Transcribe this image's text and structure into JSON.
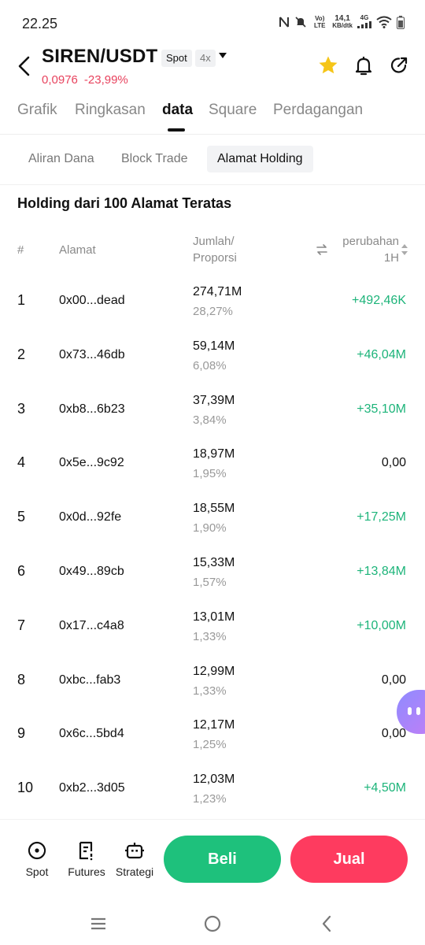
{
  "status_bar": {
    "time": "22.25",
    "network_volte": "Vo) LTE",
    "speed_value": "14,1",
    "speed_unit": "KB/dtk",
    "network_type": "4G"
  },
  "header": {
    "pair": "SIREN/USDT",
    "market_badge": "Spot",
    "leverage_badge": "4x",
    "price": "0,0976",
    "change": "-23,99%",
    "colors": {
      "negative": "#e8435e",
      "favorite": "#f5c518"
    }
  },
  "main_tabs": [
    {
      "label": "Grafik",
      "active": false
    },
    {
      "label": "Ringkasan",
      "active": false
    },
    {
      "label": "data",
      "active": true
    },
    {
      "label": "Square",
      "active": false
    },
    {
      "label": "Perdagangan",
      "active": false
    }
  ],
  "sub_tabs": [
    {
      "label": "Aliran Dana",
      "active": false
    },
    {
      "label": "Block Trade",
      "active": false
    },
    {
      "label": "Alamat Holding",
      "active": true
    }
  ],
  "holdings": {
    "title": "Holding dari 100 Alamat Teratas",
    "columns": {
      "rank": "#",
      "address": "Alamat",
      "amount_line1": "Jumlah/",
      "amount_line2": "Proporsi",
      "change_line1": "perubahan",
      "change_line2": "1H"
    },
    "rows": [
      {
        "rank": "1",
        "address": "0x00...dead",
        "amount": "274,71M",
        "proportion": "28,27%",
        "change": "+492,46K"
      },
      {
        "rank": "2",
        "address": "0x73...46db",
        "amount": "59,14M",
        "proportion": "6,08%",
        "change": "+46,04M"
      },
      {
        "rank": "3",
        "address": "0xb8...6b23",
        "amount": "37,39M",
        "proportion": "3,84%",
        "change": "+35,10M"
      },
      {
        "rank": "4",
        "address": "0x5e...9c92",
        "amount": "18,97M",
        "proportion": "1,95%",
        "change": "0,00"
      },
      {
        "rank": "5",
        "address": "0x0d...92fe",
        "amount": "18,55M",
        "proportion": "1,90%",
        "change": "+17,25M"
      },
      {
        "rank": "6",
        "address": "0x49...89cb",
        "amount": "15,33M",
        "proportion": "1,57%",
        "change": "+13,84M"
      },
      {
        "rank": "7",
        "address": "0x17...c4a8",
        "amount": "13,01M",
        "proportion": "1,33%",
        "change": "+10,00M"
      },
      {
        "rank": "8",
        "address": "0xbc...fab3",
        "amount": "12,99M",
        "proportion": "1,33%",
        "change": "0,00"
      },
      {
        "rank": "9",
        "address": "0x6c...5bd4",
        "amount": "12,17M",
        "proportion": "1,25%",
        "change": "0,00"
      },
      {
        "rank": "10",
        "address": "0xb2...3d05",
        "amount": "12,03M",
        "proportion": "1,23%",
        "change": "+4,50M"
      }
    ],
    "colors": {
      "positive": "#1db47a",
      "neutral": "#111111"
    }
  },
  "bottom_bar": {
    "nav": [
      {
        "label": "Spot",
        "icon": "spot-icon"
      },
      {
        "label": "Futures",
        "icon": "futures-icon"
      },
      {
        "label": "Strategi",
        "icon": "strategy-bot-icon"
      }
    ],
    "buy_label": "Beli",
    "sell_label": "Jual",
    "colors": {
      "buy": "#1ec17c",
      "sell": "#fe3b5f"
    }
  }
}
